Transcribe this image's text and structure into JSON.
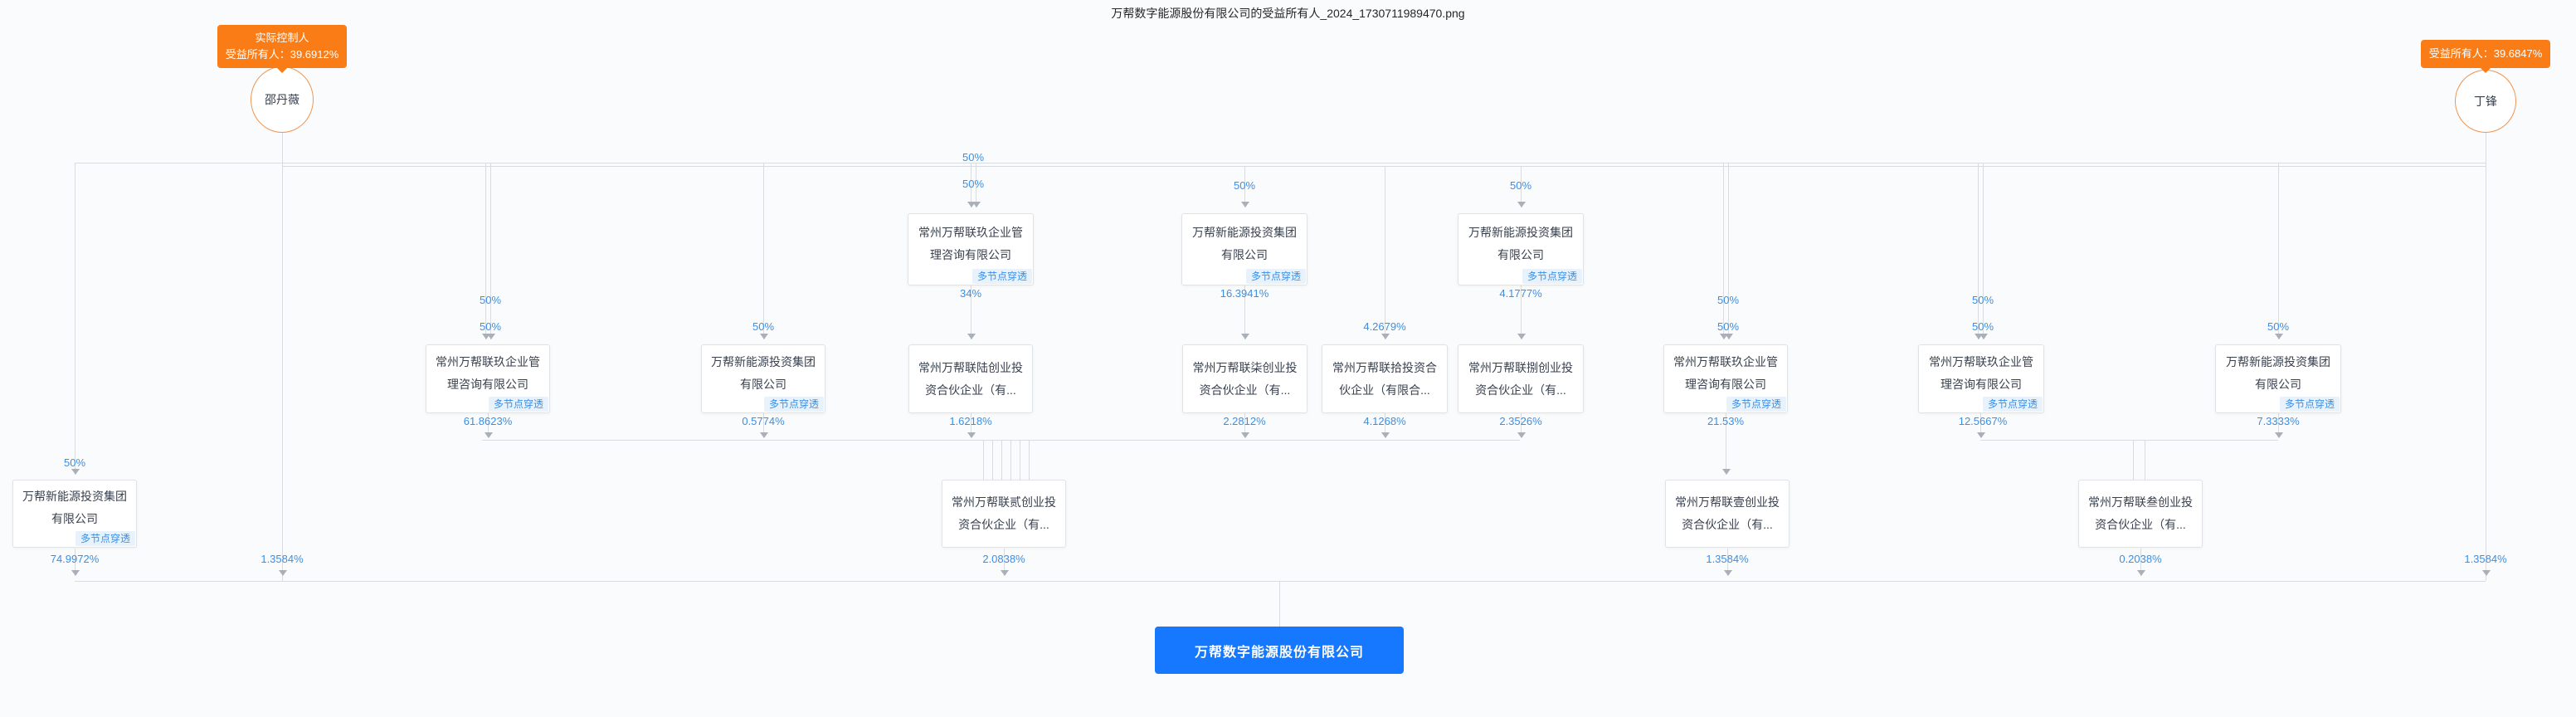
{
  "title": "万帮数字能源股份有限公司的受益所有人_2024_1730711989470.png",
  "penetrate_tag": "多节点穿透",
  "persons": [
    {
      "name": "邵丹薇",
      "badge": {
        "line1": "实际控制人",
        "line2": "受益所有人：39.6912%"
      }
    },
    {
      "name": "丁锋",
      "badge": {
        "line1": "受益所有人：39.6847%"
      }
    }
  ],
  "root": {
    "name": "万帮数字能源股份有限公司",
    "color": "#1677ff"
  },
  "nodes": [
    {
      "name": "常州万帮联玖企业管理咨询有限公司",
      "tag": true
    },
    {
      "name": "万帮新能源投资集团有限公司",
      "tag": true
    },
    {
      "name": "万帮新能源投资集团有限公司",
      "tag": true
    },
    {
      "name": "常州万帮联玖企业管理咨询有限公司",
      "tag": true
    },
    {
      "name": "万帮新能源投资集团有限公司",
      "tag": true
    },
    {
      "name": "常州万帮联陆创业投资合伙企业（有...",
      "tag": false
    },
    {
      "name": "常州万帮联柒创业投资合伙企业（有...",
      "tag": false
    },
    {
      "name": "常州万帮联拾投资合伙企业（有限合...",
      "tag": false
    },
    {
      "name": "常州万帮联捌创业投资合伙企业（有...",
      "tag": false
    },
    {
      "name": "常州万帮联玖企业管理咨询有限公司",
      "tag": true
    },
    {
      "name": "常州万帮联玖企业管理咨询有限公司",
      "tag": true
    },
    {
      "name": "万帮新能源投资集团有限公司",
      "tag": true
    },
    {
      "name": "万帮新能源投资集团有限公司",
      "tag": true
    },
    {
      "name": "常州万帮联贰创业投资合伙企业（有...",
      "tag": false
    },
    {
      "name": "常州万帮联壹创业投资合伙企业（有...",
      "tag": false
    },
    {
      "name": "常州万帮联叁创业投资合伙企业（有...",
      "tag": false
    }
  ],
  "edges": [
    {
      "label": "50%"
    },
    {
      "label": "50%"
    },
    {
      "label": "50%"
    },
    {
      "label": "50%"
    },
    {
      "label": "34%"
    },
    {
      "label": "16.3941%"
    },
    {
      "label": "4.1777%"
    },
    {
      "label": "50%"
    },
    {
      "label": "50%"
    },
    {
      "label": "50%"
    },
    {
      "label": "50%"
    },
    {
      "label": "50%"
    },
    {
      "label": "4.2679%"
    },
    {
      "label": "50%"
    },
    {
      "label": "50%"
    },
    {
      "label": "50%"
    },
    {
      "label": "61.8623%"
    },
    {
      "label": "0.5774%"
    },
    {
      "label": "1.6218%"
    },
    {
      "label": "2.2812%"
    },
    {
      "label": "4.1268%"
    },
    {
      "label": "2.3526%"
    },
    {
      "label": "21.53%"
    },
    {
      "label": "12.5667%"
    },
    {
      "label": "7.3333%"
    },
    {
      "label": "50%"
    },
    {
      "label": "74.9972%"
    },
    {
      "label": "1.3584%"
    },
    {
      "label": "2.0838%"
    },
    {
      "label": "1.3584%"
    },
    {
      "label": "0.2038%"
    },
    {
      "label": "1.3584%"
    }
  ],
  "colors": {
    "accent_blue": "#3b8fe4",
    "root_blue": "#1677ff",
    "badge_orange": "#fa7c17",
    "line_gray": "#d8dbdf",
    "box_border": "#dfe3e8"
  }
}
